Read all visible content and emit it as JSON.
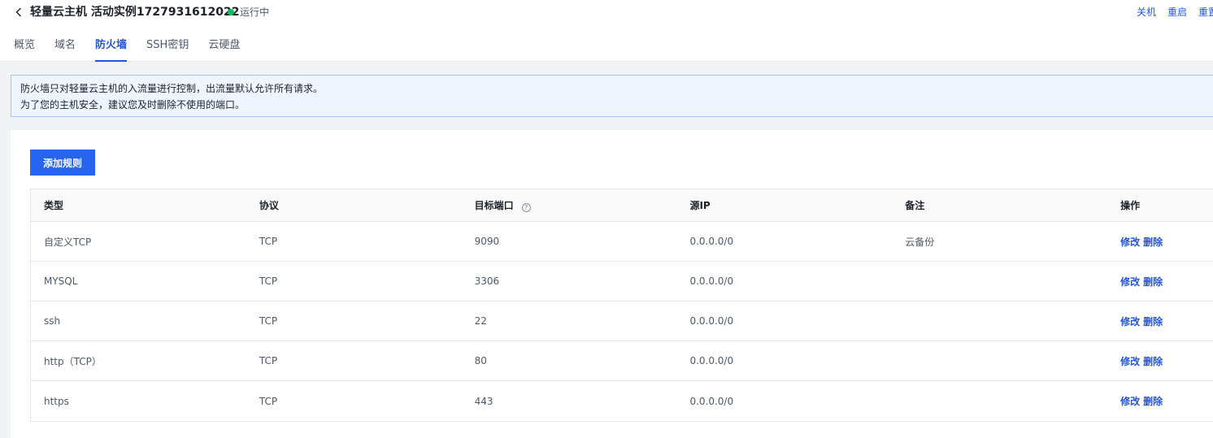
{
  "header": {
    "title": "轻量云主机 活动实例1727931612022",
    "status": "运行中",
    "status_color": "#0abf5b",
    "actions": [
      "关机",
      "重启",
      "重置"
    ]
  },
  "tabs": [
    {
      "label": "概览",
      "active": false
    },
    {
      "label": "域名",
      "active": false
    },
    {
      "label": "防火墙",
      "active": true
    },
    {
      "label": "SSH密钥",
      "active": false
    },
    {
      "label": "云硬盘",
      "active": false
    }
  ],
  "notice": {
    "line1": "防火墙只对轻量云主机的入流量进行控制，出流量默认允许所有请求。",
    "line2": "为了您的主机安全，建议您及时删除不使用的端口。"
  },
  "add_rule_label": "添加规则",
  "table": {
    "columns": [
      "类型",
      "协议",
      "目标端口",
      "源IP",
      "备注",
      "操作"
    ],
    "help_icon": "question-circle-icon",
    "rows": [
      {
        "type": "自定义TCP",
        "protocol": "TCP",
        "port": "9090",
        "source": "0.0.0.0/0",
        "remark": "云备份"
      },
      {
        "type": "MYSQL",
        "protocol": "TCP",
        "port": "3306",
        "source": "0.0.0.0/0",
        "remark": ""
      },
      {
        "type": "ssh",
        "protocol": "TCP",
        "port": "22",
        "source": "0.0.0.0/0",
        "remark": ""
      },
      {
        "type": "http（TCP）",
        "protocol": "TCP",
        "port": "80",
        "source": "0.0.0.0/0",
        "remark": ""
      },
      {
        "type": "https",
        "protocol": "TCP",
        "port": "443",
        "source": "0.0.0.0/0",
        "remark": ""
      }
    ],
    "edit_label": "修改",
    "delete_label": "删除"
  },
  "colors": {
    "accent": "#2356d8",
    "button": "#2964f0"
  }
}
